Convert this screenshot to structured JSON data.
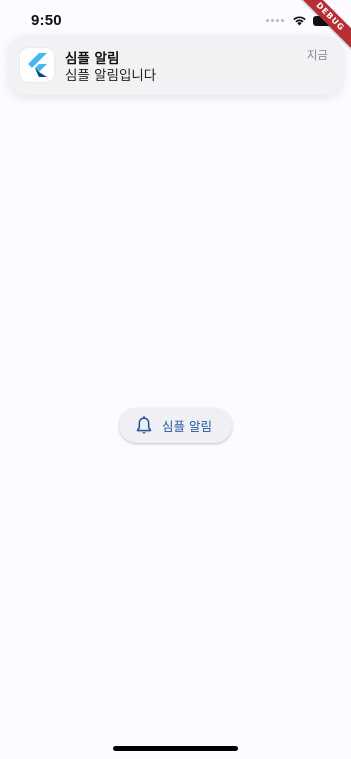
{
  "status_bar": {
    "time": "9:50",
    "icons": [
      "signal-icon",
      "wifi-icon",
      "battery-icon"
    ]
  },
  "debug_banner": {
    "label": "DEBUG",
    "color": "#b52f35"
  },
  "notification": {
    "app_icon": "flutter-logo-icon",
    "title": "심플 알림",
    "body": "심플 알림입니다",
    "time": "지금"
  },
  "main": {
    "button": {
      "icon": "bell-icon",
      "label": "심플 알림"
    }
  },
  "colors": {
    "accent": "#27599a",
    "background": "#fcfbff"
  }
}
